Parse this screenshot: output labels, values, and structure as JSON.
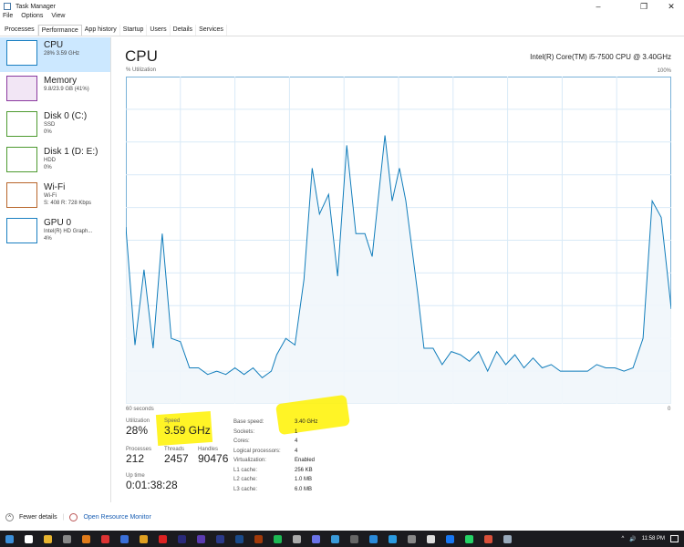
{
  "window": {
    "title": "Task Manager",
    "minimize": "–",
    "maximize": "❐",
    "close": "✕"
  },
  "menu": [
    "File",
    "Options",
    "View"
  ],
  "tabs": [
    "Processes",
    "Performance",
    "App history",
    "Startup",
    "Users",
    "Details",
    "Services"
  ],
  "active_tab": "Performance",
  "sidebar": [
    {
      "name": "CPU",
      "line1": "28% 3.59 GHz",
      "line2": "",
      "color": "#1a7fc1",
      "selected": true
    },
    {
      "name": "Memory",
      "line1": "9.8/23.9 GB (41%)",
      "line2": "",
      "color": "#8b3a9f"
    },
    {
      "name": "Disk 0 (C:)",
      "line1": "SSD",
      "line2": "0%",
      "color": "#4d9a2f"
    },
    {
      "name": "Disk 1 (D: E:)",
      "line1": "HDD",
      "line2": "0%",
      "color": "#4d9a2f"
    },
    {
      "name": "Wi-Fi",
      "line1": "Wi-Fi",
      "line2": "S: 408 R: 728 Kbps",
      "color": "#b8652a"
    },
    {
      "name": "GPU 0",
      "line1": "Intel(R) HD Graph...",
      "line2": "4%",
      "color": "#1a7fc1"
    }
  ],
  "main": {
    "title": "CPU",
    "cpu_name": "Intel(R) Core(TM) i5-7500 CPU @ 3.40GHz",
    "y_label": "% Utilization",
    "y_max": "100%",
    "x_label": "60 seconds",
    "x_min": "0"
  },
  "chart_data": {
    "type": "area",
    "xlabel": "60 seconds",
    "ylabel": "% Utilization",
    "xlim": [
      60,
      0
    ],
    "ylim": [
      0,
      100
    ],
    "grid": true,
    "color": "#117dbb",
    "points": [
      [
        60,
        54
      ],
      [
        59,
        18
      ],
      [
        58,
        41
      ],
      [
        57,
        17
      ],
      [
        56,
        52
      ],
      [
        55,
        20
      ],
      [
        54,
        19
      ],
      [
        53,
        11
      ],
      [
        52,
        11
      ],
      [
        51,
        9
      ],
      [
        50,
        10
      ],
      [
        49,
        9
      ],
      [
        48,
        11
      ],
      [
        47,
        9
      ],
      [
        46,
        11
      ],
      [
        45,
        8
      ],
      [
        44,
        10
      ],
      [
        43.4,
        15
      ],
      [
        42.4,
        20
      ],
      [
        41.4,
        18
      ],
      [
        40.4,
        38
      ],
      [
        39.5,
        72
      ],
      [
        38.7,
        58
      ],
      [
        37.7,
        64
      ],
      [
        36.7,
        39
      ],
      [
        35.7,
        79
      ],
      [
        34.7,
        52
      ],
      [
        33.7,
        52
      ],
      [
        32.9,
        45
      ],
      [
        32.3,
        61
      ],
      [
        31.5,
        82
      ],
      [
        30.7,
        62
      ],
      [
        29.9,
        72
      ],
      [
        29.2,
        62
      ],
      [
        27.9,
        34
      ],
      [
        27.2,
        17
      ],
      [
        26.2,
        17
      ],
      [
        25.2,
        12
      ],
      [
        24.2,
        16
      ],
      [
        23.2,
        15
      ],
      [
        22.2,
        13
      ],
      [
        21.2,
        16
      ],
      [
        20.2,
        10
      ],
      [
        19.2,
        16
      ],
      [
        18.2,
        12
      ],
      [
        17.2,
        15
      ],
      [
        16.2,
        11
      ],
      [
        15.2,
        14
      ],
      [
        14.2,
        11
      ],
      [
        13.2,
        12
      ],
      [
        12.2,
        10
      ],
      [
        11.2,
        10
      ],
      [
        10.2,
        10
      ],
      [
        9.2,
        10
      ],
      [
        8.2,
        12
      ],
      [
        7.2,
        11
      ],
      [
        6.2,
        11
      ],
      [
        5.2,
        10
      ],
      [
        4.2,
        11
      ],
      [
        3.1,
        20
      ],
      [
        2.1,
        62
      ],
      [
        1.1,
        57
      ],
      [
        0,
        29
      ]
    ]
  },
  "stats": {
    "utilization_label": "Utilization",
    "utilization": "28%",
    "speed_label": "Speed",
    "speed": "3.59 GHz",
    "processes_label": "Processes",
    "processes": "212",
    "threads_label": "Threads",
    "threads": "2457",
    "handles_label": "Handles",
    "handles": "90476",
    "uptime_label": "Up time",
    "uptime": "0:01:38:28"
  },
  "details": [
    [
      "Base speed:",
      "3.40 GHz"
    ],
    [
      "Sockets:",
      "1"
    ],
    [
      "Cores:",
      "4"
    ],
    [
      "Logical processors:",
      "4"
    ],
    [
      "Virtualization:",
      "Enabled"
    ],
    [
      "L1 cache:",
      "256 KB"
    ],
    [
      "L2 cache:",
      "1.0 MB"
    ],
    [
      "L3 cache:",
      "6.0 MB"
    ]
  ],
  "footer": {
    "fewer_details": "Fewer details",
    "resource_monitor": "Open Resource Monitor"
  },
  "taskbar": {
    "icons": [
      "windows-start",
      "search",
      "file-explorer",
      "store",
      "vlc",
      "app-red",
      "app-blue",
      "chrome",
      "opera",
      "premiere",
      "after-effects",
      "media-encoder",
      "photoshop",
      "illustrator",
      "spotify",
      "steam",
      "discord",
      "app-circle",
      "app-generic",
      "app-blue2",
      "app-blue3",
      "github",
      "app-box",
      "facebook",
      "whatsapp",
      "chrome-2",
      "task-manager"
    ],
    "icon_colors": [
      "#3b8fd9",
      "#fff",
      "#e8b530",
      "#888",
      "#e07b1a",
      "#d33",
      "#3a6fd8",
      "#e0a020",
      "#d22",
      "#2a2a7a",
      "#5b3bb0",
      "#2b3a8a",
      "#1a4a8a",
      "#a23a0a",
      "#1db954",
      "#aaa",
      "#6a73e8",
      "#3a9ad9",
      "#666",
      "#2a8ad9",
      "#2a9ae0",
      "#888",
      "#ddd",
      "#1877f2",
      "#25d366",
      "#d9503a",
      "#99aabb"
    ],
    "time": "11:58 PM",
    "tray_arrow": "^",
    "volume": "🔊"
  }
}
